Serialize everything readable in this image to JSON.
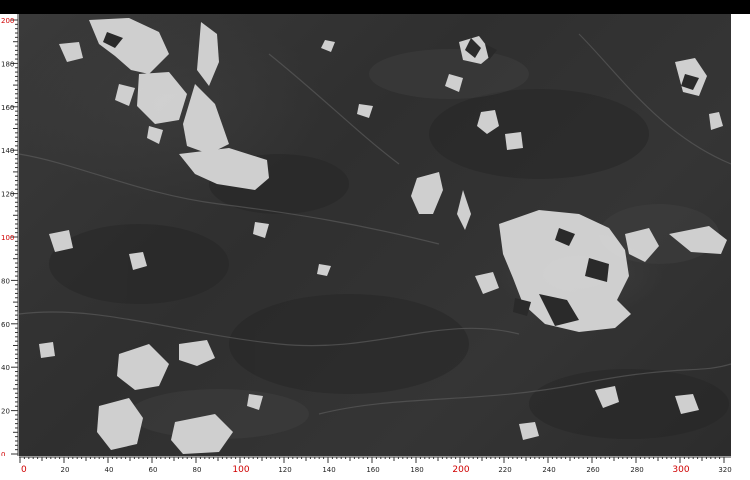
{
  "image": {
    "subject": "polished dark grey marble slab with white calcite veins and patches",
    "ruler_left": {
      "labels": [
        "200",
        "180",
        "160",
        "140",
        "120",
        "100",
        "80",
        "60",
        "40",
        "20",
        "0"
      ],
      "red_labels": [
        "200",
        "100",
        "0"
      ],
      "color_black": "#222222",
      "color_red": "#d00000"
    },
    "ruler_bottom": {
      "labels": [
        "0",
        "20",
        "40",
        "60",
        "80",
        "100",
        "120",
        "140",
        "160",
        "180",
        "200",
        "220",
        "240",
        "260",
        "280",
        "300",
        "320"
      ],
      "red_labels": [
        "0",
        "100",
        "200",
        "300"
      ],
      "color_black": "#222222",
      "color_red": "#d00000"
    },
    "colors": {
      "slab_base": "#333333",
      "veins": "#d9d9d9",
      "top_bar": "#000000"
    }
  }
}
